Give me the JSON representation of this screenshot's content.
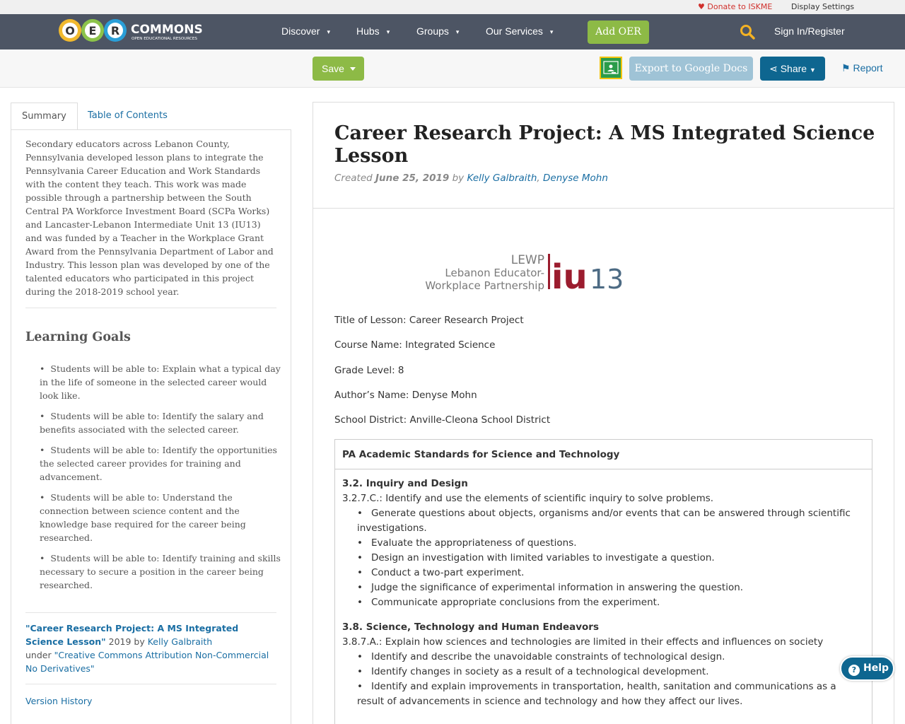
{
  "topstrip": {
    "donate": "Donate to ISKME",
    "display_settings": "Display Settings"
  },
  "nav": {
    "logo_text": "COMMONS",
    "logo_sub": "OPEN EDUCATIONAL RESOURCES",
    "logo_letters": [
      "O",
      "E",
      "R"
    ],
    "items": [
      "Discover",
      "Hubs",
      "Groups",
      "Our Services"
    ],
    "add_oer": "Add OER",
    "signin": "Sign In/Register"
  },
  "toolbar": {
    "save": "Save",
    "export": "Export to Google Docs",
    "share": "Share",
    "report": "Report"
  },
  "tabs": {
    "summary": "Summary",
    "toc": "Table of Contents"
  },
  "summary": {
    "text": "Secondary educators across Lebanon County, Pennsylvania developed lesson plans to integrate the Pennsylvania Career Education and Work Standards with the content they teach. This work was made possible through a partnership between the South Central PA Workforce Investment Board (SCPa Works) and Lancaster-Lebanon Intermediate Unit 13 (IU13) and was funded by a Teacher in the Workplace Grant Award from the Pennsylvania Department of Labor and Industry. This lesson plan was developed by one of the talented educators who participated in this project during the 2018-2019 school year.",
    "goals_title": "Learning Goals",
    "goals": [
      "Students will be able to: Explain what a typical day in the life of someone in the selected career would look like.",
      "Students will be able to: Identify the salary and benefits associated with the selected career.",
      "Students will be able to: Identify the opportunities the selected career provides for training and advancement.",
      "Students will be able to: Understand the connection between science content and the knowledge base required for the career being researched.",
      "Students will be able to: Identify training and skills necessary to secure a position in the career being researched."
    ],
    "license_title": "\"Career Research Project: A MS Integrated Science Lesson\"",
    "license_year_by": " 2019 by ",
    "license_author": "Kelly Galbraith",
    "license_under": "under ",
    "license_name": "\"Creative Commons Attribution Non-Commercial No Derivatives\"",
    "version_history": "Version History"
  },
  "main": {
    "title": "Career Research Project: A MS Integrated Science Lesson",
    "created_label": "Created ",
    "created_date": "June 25, 2019",
    "by_label": " by ",
    "author1": "Kelly Galbraith",
    "comma": ", ",
    "author2": "Denyse Mohn",
    "logo_lewp": "LEWP",
    "logo_line1": "Lebanon Educator-",
    "logo_line2": "Workplace Partnership",
    "logo_iu": "iu",
    "logo_13": "13",
    "info": [
      "Title of Lesson: Career Research Project",
      "Course Name:  Integrated Science",
      "Grade Level:  8",
      "Author’s Name:  Denyse Mohn",
      "School District:  Anville-Cleona School District"
    ],
    "standards_head": "PA Academic Standards for Science and Technology",
    "sec1_title": "3.2. Inquiry and Design",
    "sec1_sub": "3.2.7.C.: Identify and use the elements of scientific inquiry to solve problems.",
    "sec1_items": [
      "Generate questions about objects, organisms and/or events that can be answered through scientific investigations.",
      "Evaluate the appropriateness of questions.",
      "Design an investigation with limited variables to investigate a question.",
      "Conduct a two-part experiment.",
      "Judge the significance of experimental information in answering the question.",
      "Communicate appropriate conclusions from the experiment."
    ],
    "sec2_title": "3.8. Science, Technology and Human Endeavors",
    "sec2_sub": "3.8.7.A.:  Explain how sciences and technologies are limited in their effects and influences on society",
    "sec2_items": [
      "Identify and describe the unavoidable constraints of technological design.",
      "Identify changes in society as a result of a technological development.",
      "Identify and explain improvements in transportation, health, sanitation and communications as a result of advancements in science and technology and how they affect our lives."
    ]
  },
  "help": "Help"
}
